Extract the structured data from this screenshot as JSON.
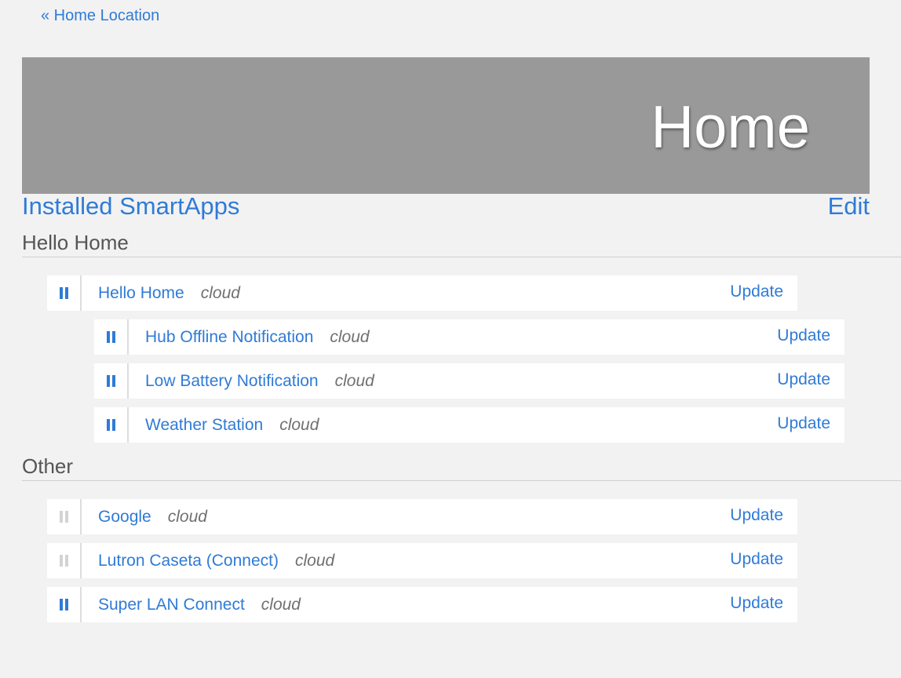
{
  "nav": {
    "back_label": "« Home Location"
  },
  "banner": {
    "title": "Home",
    "background": "#999999"
  },
  "smartapps": {
    "heading": "Installed SmartApps",
    "edit_label": "Edit"
  },
  "accent": "#2f7bd6",
  "sections": [
    {
      "title": "Hello Home",
      "apps": [
        {
          "name": "Hello Home",
          "location": "cloud",
          "action": "Update",
          "level": 0,
          "paused_state": "active"
        },
        {
          "name": "Hub Offline Notification",
          "location": "cloud",
          "action": "Update",
          "level": 1,
          "paused_state": "active"
        },
        {
          "name": "Low Battery Notification",
          "location": "cloud",
          "action": "Update",
          "level": 1,
          "paused_state": "active"
        },
        {
          "name": "Weather Station",
          "location": "cloud",
          "action": "Update",
          "level": 1,
          "paused_state": "active"
        }
      ]
    },
    {
      "title": "Other",
      "apps": [
        {
          "name": "Google",
          "location": "cloud",
          "action": "Update",
          "level": 0,
          "paused_state": "disabled"
        },
        {
          "name": "Lutron Caseta (Connect)",
          "location": "cloud",
          "action": "Update",
          "level": 0,
          "paused_state": "disabled"
        },
        {
          "name": "Super LAN Connect",
          "location": "cloud",
          "action": "Update",
          "level": 0,
          "paused_state": "active"
        }
      ]
    }
  ]
}
